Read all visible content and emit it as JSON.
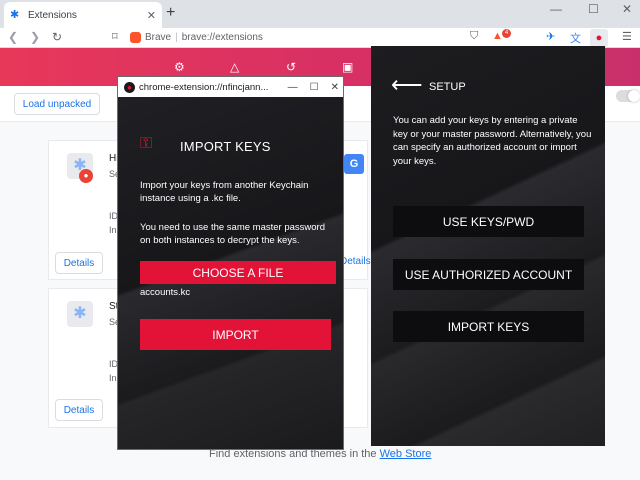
{
  "browser": {
    "tab_title": "Extensions",
    "tab_close": "✕",
    "new_tab": "+",
    "url_site": "Brave",
    "url_path": "brave://extensions",
    "ext_badge": "4"
  },
  "extensions_page": {
    "load_unpacked": "Load unpacked",
    "card1": {
      "name": "Hi",
      "line1": "Se",
      "line2": "ID",
      "line3": "In",
      "details": "Details"
    },
    "card2": {
      "name": "St",
      "line1": "Se",
      "line2": "ID",
      "line3": "In",
      "details": "Details"
    },
    "details_right": "Details",
    "footer_text": "Find extensions and themes in the ",
    "footer_link": "Web Store"
  },
  "popup": {
    "window_title": "chrome-extension://nfincjann...",
    "heading": "IMPORT KEYS",
    "text1": "Import your keys from another Keychain instance using a .kc file.",
    "text2": "You need to use the same master password on both instances to decrypt the keys.",
    "choose_file": "CHOOSE A FILE",
    "file_name": "accounts.kc",
    "import_button": "IMPORT"
  },
  "setup": {
    "title": "SETUP",
    "text": "You can add your keys by entering a private key or your master password. Alternatively, you can specify an authorized account or import your keys.",
    "btn_keys": "USE KEYS/PWD",
    "btn_authorized": "USE AUTHORIZED ACCOUNT",
    "btn_import": "IMPORT KEYS"
  },
  "icons": [
    "puzzle-icon",
    "back-icon",
    "forward-icon",
    "reload-icon",
    "bookmark-icon",
    "brave-shield-icon",
    "brave-rewards-icon",
    "extension-icon",
    "translate-icon",
    "keychain-icon",
    "menu-icon",
    "key-icon",
    "arrow-left-icon",
    "minimize-icon",
    "maximize-icon",
    "close-icon"
  ],
  "colors": {
    "accent": "#e31337",
    "pink_bar": "#e8385a",
    "link": "#1a73e8",
    "panel_bg": "#1a1a1d"
  }
}
